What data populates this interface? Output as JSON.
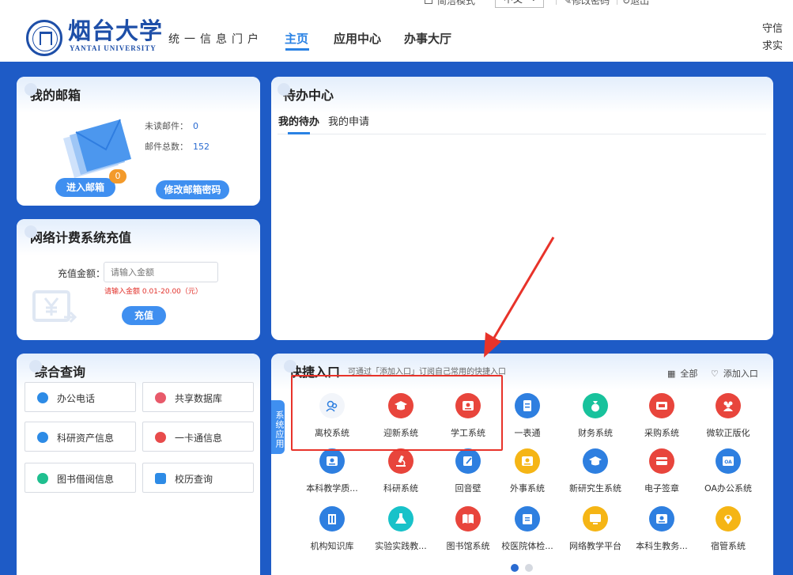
{
  "topbar": {
    "mode_label": "简洁模式",
    "language": "中文",
    "change_password": "修改密码",
    "logout": "退出"
  },
  "header": {
    "logo_cn": "烟台大学",
    "logo_en": "YANTAI UNIVERSITY",
    "portal_title": "统一信息门户",
    "nav": [
      "主页",
      "应用中心",
      "办事大厅"
    ],
    "motto": "守信求实"
  },
  "mailbox": {
    "title": "我的邮箱",
    "unread_label": "未读邮件：",
    "unread_value": "0",
    "total_label": "邮件总数：",
    "total_value": "152",
    "enter_button": "进入邮箱",
    "badge": "0",
    "change_password_button": "修改邮箱密码"
  },
  "recharge": {
    "title": "网络计费系统充值",
    "amount_label": "充值金额：",
    "amount_placeholder": "请输入金额",
    "hint": "请输入金额 0.01-20.00（元）",
    "submit_button": "充值"
  },
  "query": {
    "title": "综合查询",
    "items": [
      {
        "label": "办公电话",
        "color": "#2d8be6"
      },
      {
        "label": "共享数据库",
        "color": "#e85a6a"
      },
      {
        "label": "科研资产信息",
        "color": "#2d8be6"
      },
      {
        "label": "一卡通信息",
        "color": "#e84b4b"
      },
      {
        "label": "图书借阅信息",
        "color": "#1fbf8f"
      },
      {
        "label": "校历查询",
        "color": "#2d8be6"
      }
    ]
  },
  "todo": {
    "title": "待办中心",
    "tabs": [
      "我的待办",
      "我的申请"
    ]
  },
  "quick": {
    "title": "快捷入口",
    "hint": "可通过「添加入口」订阅自己常用的快捷入口",
    "all_label": "全部",
    "add_label": "添加入口",
    "side_tab": "系统应用",
    "apps": [
      {
        "label": "离校系统",
        "color": "#f2f5fa",
        "icon": "people-icon"
      },
      {
        "label": "迎新系统",
        "color": "#e8453c",
        "icon": "graduation-cap-icon"
      },
      {
        "label": "学工系统",
        "color": "#e8453c",
        "icon": "id-card-icon"
      },
      {
        "label": "一表通",
        "color": "#2e7fe0",
        "icon": "form-icon"
      },
      {
        "label": "财务系统",
        "color": "#18c29c",
        "icon": "money-bag-icon"
      },
      {
        "label": "采购系统",
        "color": "#e8453c",
        "icon": "cart-icon"
      },
      {
        "label": "微软正版化",
        "color": "#e8453c",
        "icon": "users-icon"
      },
      {
        "label": "本科教学质...",
        "color": "#2e7fe0",
        "icon": "id-card-icon"
      },
      {
        "label": "科研系统",
        "color": "#e8453c",
        "icon": "microscope-icon"
      },
      {
        "label": "回音壁",
        "color": "#2e7fe0",
        "icon": "edit-icon"
      },
      {
        "label": "外事系统",
        "color": "#f5b515",
        "icon": "id-card-icon"
      },
      {
        "label": "新研究生系统",
        "color": "#2e7fe0",
        "icon": "graduation-cap-icon"
      },
      {
        "label": "电子签章",
        "color": "#e8453c",
        "icon": "card-icon"
      },
      {
        "label": "OA办公系统",
        "color": "#2e7fe0",
        "icon": "oa-icon"
      },
      {
        "label": "机构知识库",
        "color": "#2e7fe0",
        "icon": "building-icon"
      },
      {
        "label": "实验实践教...",
        "color": "#18c2c9",
        "icon": "flask-icon"
      },
      {
        "label": "图书馆系统",
        "color": "#e8453c",
        "icon": "book-icon"
      },
      {
        "label": "校医院体检...",
        "color": "#2e7fe0",
        "icon": "clipboard-icon"
      },
      {
        "label": "网络教学平台",
        "color": "#f5b515",
        "icon": "monitor-icon"
      },
      {
        "label": "本科生教务...",
        "color": "#2e7fe0",
        "icon": "id-card-icon"
      },
      {
        "label": "宿管系统",
        "color": "#f5b515",
        "icon": "location-icon"
      }
    ],
    "pages": 2,
    "current_page": 1
  }
}
